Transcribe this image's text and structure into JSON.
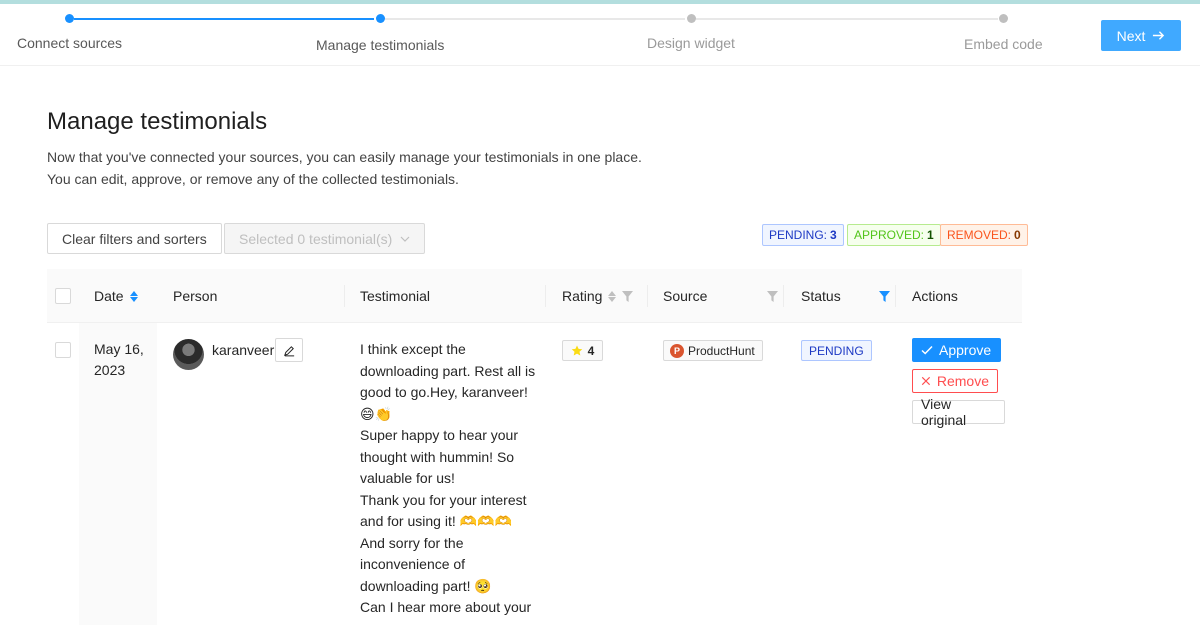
{
  "stepper": {
    "steps": [
      {
        "label": "Connect sources"
      },
      {
        "label": "Manage testimonials"
      },
      {
        "label": "Design widget"
      },
      {
        "label": "Embed code"
      }
    ],
    "next_label": "Next"
  },
  "page": {
    "title": "Manage testimonials",
    "description": "Now that you've connected your sources, you can easily manage your testimonials in one place. You can edit, approve, or remove any of the collected testimonials."
  },
  "toolbar": {
    "clear_label": "Clear filters and sorters",
    "selected_label": "Selected 0 testimonial(s)"
  },
  "counts": {
    "pending_label": "PENDING:",
    "pending": "3",
    "approved_label": "APPROVED:",
    "approved": "1",
    "removed_label": "REMOVED:",
    "removed": "0"
  },
  "table": {
    "columns": {
      "date": "Date",
      "person": "Person",
      "testimonial": "Testimonial",
      "rating": "Rating",
      "source": "Source",
      "status": "Status",
      "actions": "Actions"
    },
    "rows": [
      {
        "date_line1": "May 16,",
        "date_line2": "2023",
        "person": "karanveer",
        "testimonial_lines": [
          "I think except the downloading part. Rest all is good to go.Hey, karanveer! 😄👏",
          "Super happy to hear your thought with hummin! So valuable for us!",
          "Thank you for your interest and for using it! 🫶🫶🫶",
          "And sorry for the inconvenience of downloading part! 🥺",
          "Can I hear more about your"
        ],
        "rating": "4",
        "source": "ProductHunt",
        "source_logo": "P",
        "status": "PENDING",
        "actions": {
          "approve": "Approve",
          "remove": "Remove",
          "view": "View original"
        }
      }
    ]
  },
  "colors": {
    "primary": "#1890ff",
    "danger": "#ff4d4f",
    "star": "#fadb14"
  }
}
